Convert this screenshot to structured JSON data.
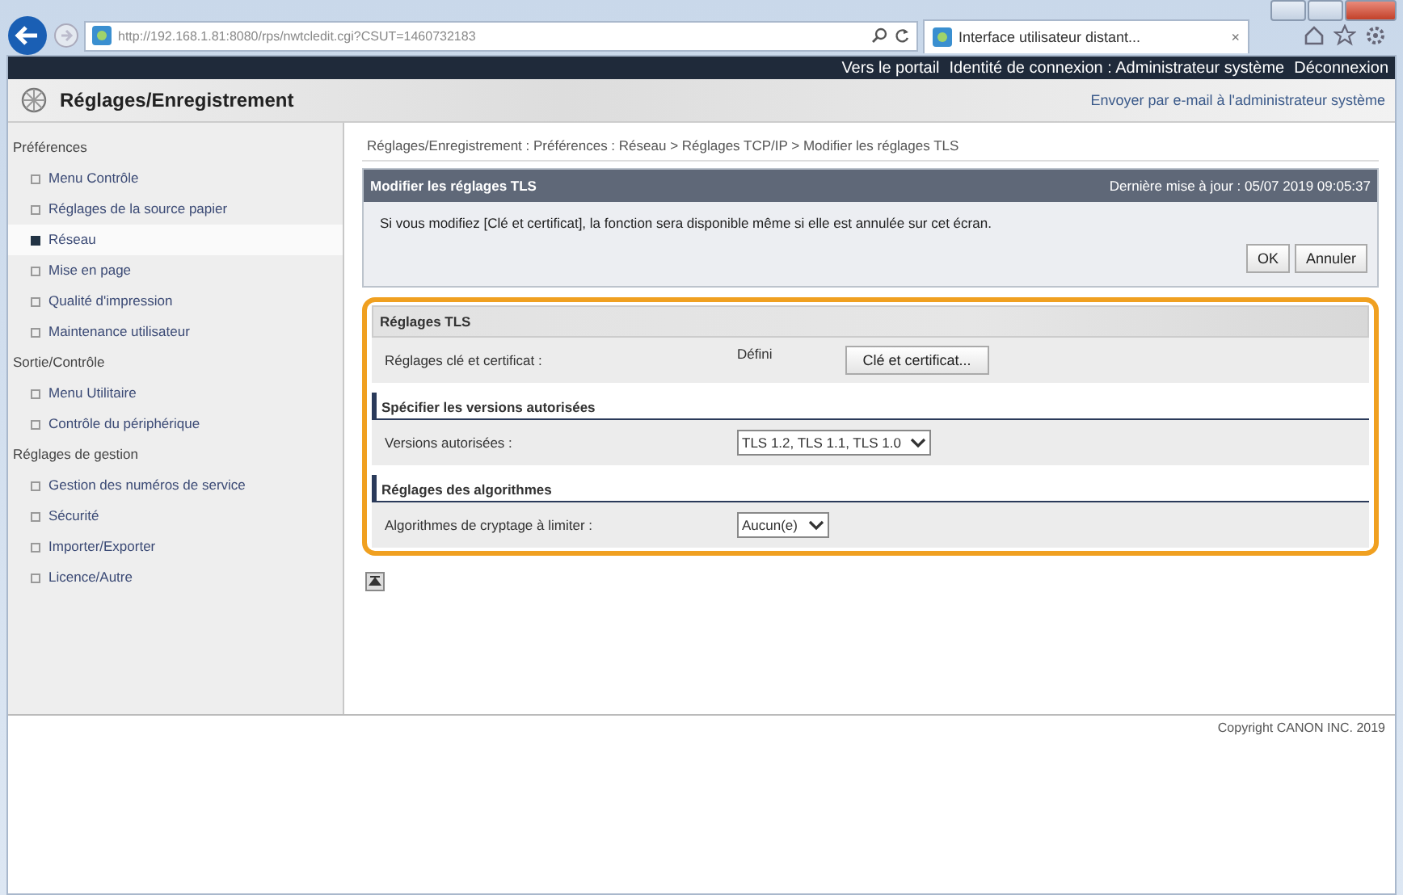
{
  "browser": {
    "address": "http://192.168.1.81:8080/rps/nwtcledit.cgi?CSUT=1460732183",
    "tab_title": "Interface utilisateur distant...",
    "tab_close": "×"
  },
  "top_bar": {
    "links": [
      "Vers le portail",
      "Identité de connexion : Administrateur système",
      "Déconnexion"
    ]
  },
  "header": {
    "title": "Réglages/Enregistrement",
    "mail_link": "Envoyer par e-mail à l'administrateur système"
  },
  "sidebar": {
    "groups": [
      {
        "label": "Préférences",
        "items": [
          {
            "label": "Menu Contrôle",
            "selected": false
          },
          {
            "label": "Réglages de la source papier",
            "selected": false
          },
          {
            "label": "Réseau",
            "selected": true
          },
          {
            "label": "Mise en page",
            "selected": false
          },
          {
            "label": "Qualité d'impression",
            "selected": false
          },
          {
            "label": "Maintenance utilisateur",
            "selected": false
          }
        ]
      },
      {
        "label": "Sortie/Contrôle",
        "items": [
          {
            "label": "Menu Utilitaire",
            "selected": false
          },
          {
            "label": "Contrôle du périphérique",
            "selected": false
          }
        ]
      },
      {
        "label": "Réglages de gestion",
        "items": [
          {
            "label": "Gestion des numéros de service",
            "selected": false
          },
          {
            "label": "Sécurité",
            "selected": false
          },
          {
            "label": "Importer/Exporter",
            "selected": false
          },
          {
            "label": "Licence/Autre",
            "selected": false
          }
        ]
      }
    ]
  },
  "breadcrumb": "Réglages/Enregistrement : Préférences : Réseau > Réglages TCP/IP > Modifier les réglages TLS",
  "panel": {
    "title": "Modifier les réglages TLS",
    "updated": "Dernière mise à jour : 05/07 2019 09:05:37",
    "message": "Si vous modifiez [Clé et certificat], la fonction sera disponible même si elle est annulée sur cet écran.",
    "buttons": [
      "OK",
      "Annuler"
    ]
  },
  "sections": [
    {
      "title": "Réglages TLS",
      "kind": "box",
      "rows": [
        {
          "label": "Réglages clé et certificat :",
          "value": "Défini",
          "button": "Clé et certificat..."
        }
      ]
    },
    {
      "title": "Spécifier les versions autorisées",
      "kind": "bar",
      "rows": [
        {
          "label": "Versions autorisées :",
          "select": "TLS 1.2, TLS 1.1, TLS 1.0"
        }
      ]
    },
    {
      "title": "Réglages des algorithmes",
      "kind": "bar",
      "rows": [
        {
          "label": "Algorithmes de cryptage à limiter :",
          "select": "Aucun(e)"
        }
      ]
    }
  ],
  "copyright": "Copyright CANON INC. 2019"
}
